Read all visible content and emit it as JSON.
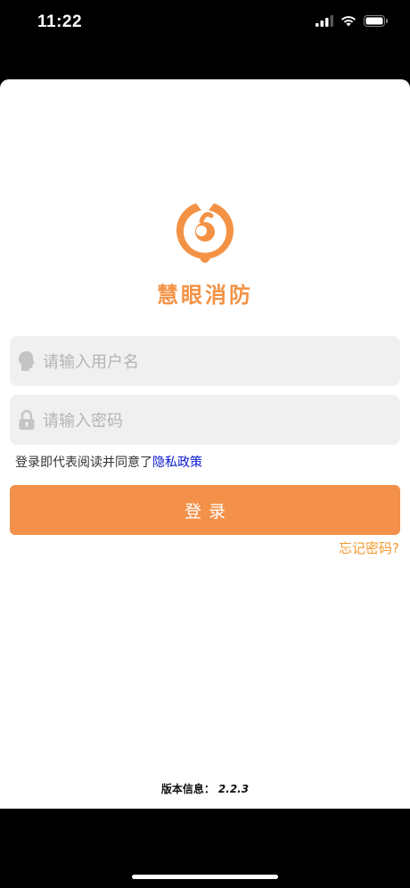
{
  "status_bar": {
    "time": "11:22"
  },
  "app": {
    "name": "慧眼消防",
    "brand_color": "#f39245"
  },
  "form": {
    "username_placeholder": "请输入用户名",
    "password_placeholder": "请输入密码",
    "agree_text": "登录即代表阅读并同意了",
    "policy_link": "隐私政策",
    "login_label": "登录",
    "forgot_label": "忘记密码?"
  },
  "footer": {
    "version_label": "版本信息：",
    "version_number": "2.2.3"
  }
}
